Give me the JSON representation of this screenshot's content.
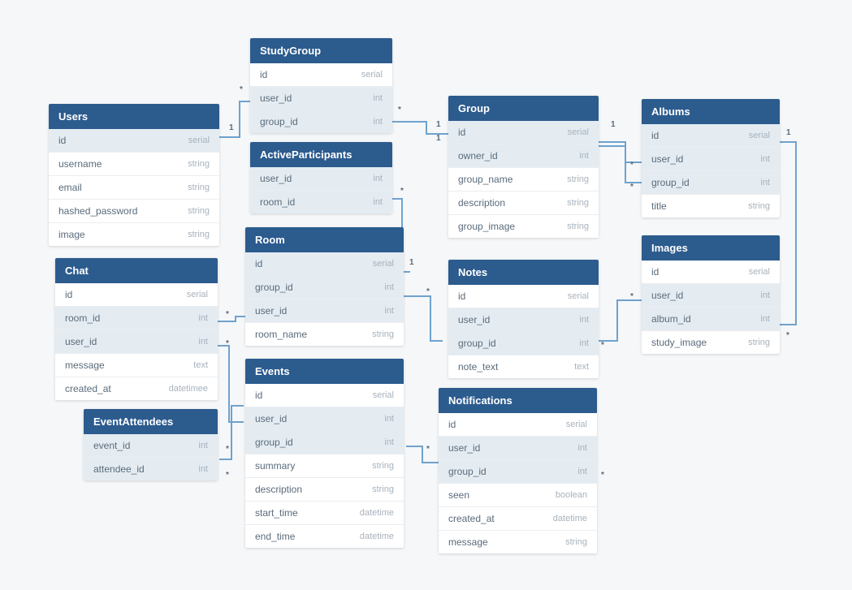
{
  "tables": {
    "users": {
      "title": "Users",
      "fields": [
        {
          "name": "id",
          "type": "serial",
          "alt": true
        },
        {
          "name": "username",
          "type": "string",
          "alt": false
        },
        {
          "name": "email",
          "type": "string",
          "alt": false
        },
        {
          "name": "hashed_password",
          "type": "string",
          "alt": false
        },
        {
          "name": "image",
          "type": "string",
          "alt": false
        }
      ]
    },
    "studygroup": {
      "title": "StudyGroup",
      "fields": [
        {
          "name": "id",
          "type": "serial",
          "alt": false
        },
        {
          "name": "user_id",
          "type": "int",
          "alt": true
        },
        {
          "name": "group_id",
          "type": "int",
          "alt": true
        }
      ]
    },
    "group": {
      "title": "Group",
      "fields": [
        {
          "name": "id",
          "type": "serial",
          "alt": true
        },
        {
          "name": "owner_id",
          "type": "int",
          "alt": true
        },
        {
          "name": "group_name",
          "type": "string",
          "alt": false
        },
        {
          "name": "description",
          "type": "string",
          "alt": false
        },
        {
          "name": "group_image",
          "type": "string",
          "alt": false
        }
      ]
    },
    "albums": {
      "title": "Albums",
      "fields": [
        {
          "name": "id",
          "type": "serial",
          "alt": true
        },
        {
          "name": "user_id",
          "type": "int",
          "alt": true
        },
        {
          "name": "group_id",
          "type": "int",
          "alt": true
        },
        {
          "name": "title",
          "type": "string",
          "alt": false
        }
      ]
    },
    "activeparticipants": {
      "title": "ActiveParticipants",
      "fields": [
        {
          "name": "user_id",
          "type": "int",
          "alt": true
        },
        {
          "name": "room_id",
          "type": "int",
          "alt": true
        }
      ]
    },
    "room": {
      "title": "Room",
      "fields": [
        {
          "name": "id",
          "type": "serial",
          "alt": true
        },
        {
          "name": "group_id",
          "type": "int",
          "alt": true
        },
        {
          "name": "user_id",
          "type": "int",
          "alt": true
        },
        {
          "name": "room_name",
          "type": "string",
          "alt": false
        }
      ]
    },
    "images": {
      "title": "Images",
      "fields": [
        {
          "name": "id",
          "type": "serial",
          "alt": false
        },
        {
          "name": "user_id",
          "type": "int",
          "alt": true
        },
        {
          "name": "album_id",
          "type": "int",
          "alt": true
        },
        {
          "name": "study_image",
          "type": "string",
          "alt": false
        }
      ]
    },
    "chat": {
      "title": "Chat",
      "fields": [
        {
          "name": "id",
          "type": "serial",
          "alt": false
        },
        {
          "name": "room_id",
          "type": "int",
          "alt": true
        },
        {
          "name": "user_id",
          "type": "int",
          "alt": true
        },
        {
          "name": "message",
          "type": "text",
          "alt": false
        },
        {
          "name": "created_at",
          "type": "datetimee",
          "alt": false
        }
      ]
    },
    "notes": {
      "title": "Notes",
      "fields": [
        {
          "name": "id",
          "type": "serial",
          "alt": false
        },
        {
          "name": "user_id",
          "type": "int",
          "alt": true
        },
        {
          "name": "group_id",
          "type": "int",
          "alt": true
        },
        {
          "name": "note_text",
          "type": "text",
          "alt": false
        }
      ]
    },
    "events": {
      "title": "Events",
      "fields": [
        {
          "name": "id",
          "type": "serial",
          "alt": false
        },
        {
          "name": "user_id",
          "type": "int",
          "alt": true
        },
        {
          "name": "group_id",
          "type": "int",
          "alt": true
        },
        {
          "name": "summary",
          "type": "string",
          "alt": false
        },
        {
          "name": "description",
          "type": "string",
          "alt": false
        },
        {
          "name": "start_time",
          "type": "datetime",
          "alt": false
        },
        {
          "name": "end_time",
          "type": "datetime",
          "alt": false
        }
      ]
    },
    "eventattendees": {
      "title": "EventAttendees",
      "fields": [
        {
          "name": "event_id",
          "type": "int",
          "alt": true
        },
        {
          "name": "attendee_id",
          "type": "int",
          "alt": true
        }
      ]
    },
    "notifications": {
      "title": "Notifications",
      "fields": [
        {
          "name": "id",
          "type": "serial",
          "alt": false
        },
        {
          "name": "user_id",
          "type": "int",
          "alt": true
        },
        {
          "name": "group_id",
          "type": "int",
          "alt": true
        },
        {
          "name": "seen",
          "type": "boolean",
          "alt": false
        },
        {
          "name": "created_at",
          "type": "datetime",
          "alt": false
        },
        {
          "name": "message",
          "type": "string",
          "alt": false
        }
      ]
    }
  },
  "cardinality_labels": [
    "1",
    "*"
  ],
  "relationships": [
    {
      "from": "StudyGroup.user_id",
      "to": "Users.id",
      "card": "* to 1"
    },
    {
      "from": "StudyGroup.group_id",
      "to": "Group.id",
      "card": "* to 1"
    },
    {
      "from": "Group.owner_id",
      "to": "Users.id",
      "card": "1 to 1"
    },
    {
      "from": "Albums.user_id",
      "to": "Users.id",
      "card": "* to 1"
    },
    {
      "from": "Albums.group_id",
      "to": "Group.id",
      "card": "* to 1"
    },
    {
      "from": "ActiveParticipants.user_id",
      "to": "Users.id",
      "card": "* to 1"
    },
    {
      "from": "ActiveParticipants.room_id",
      "to": "Room.id",
      "card": "* to 1"
    },
    {
      "from": "Room.group_id",
      "to": "Group.id",
      "card": "* to 1"
    },
    {
      "from": "Room.user_id",
      "to": "Users.id",
      "card": "* to 1"
    },
    {
      "from": "Images.user_id",
      "to": "Users.id",
      "card": "* to 1"
    },
    {
      "from": "Images.album_id",
      "to": "Albums.id",
      "card": "* to 1"
    },
    {
      "from": "Chat.room_id",
      "to": "Room.id",
      "card": "* to 1"
    },
    {
      "from": "Chat.user_id",
      "to": "Users.id",
      "card": "* to 1"
    },
    {
      "from": "Notes.user_id",
      "to": "Users.id",
      "card": "* to 1"
    },
    {
      "from": "Notes.group_id",
      "to": "Group.id",
      "card": "* to 1"
    },
    {
      "from": "Events.user_id",
      "to": "Users.id",
      "card": "* to 1"
    },
    {
      "from": "Events.group_id",
      "to": "Group.id",
      "card": "* to 1"
    },
    {
      "from": "EventAttendees.event_id",
      "to": "Events.id",
      "card": "* to 1"
    },
    {
      "from": "EventAttendees.attendee_id",
      "to": "Users.id",
      "card": "* to 1"
    },
    {
      "from": "Notifications.user_id",
      "to": "Users.id",
      "card": "* to 1"
    },
    {
      "from": "Notifications.group_id",
      "to": "Group.id",
      "card": "* to 1"
    }
  ]
}
